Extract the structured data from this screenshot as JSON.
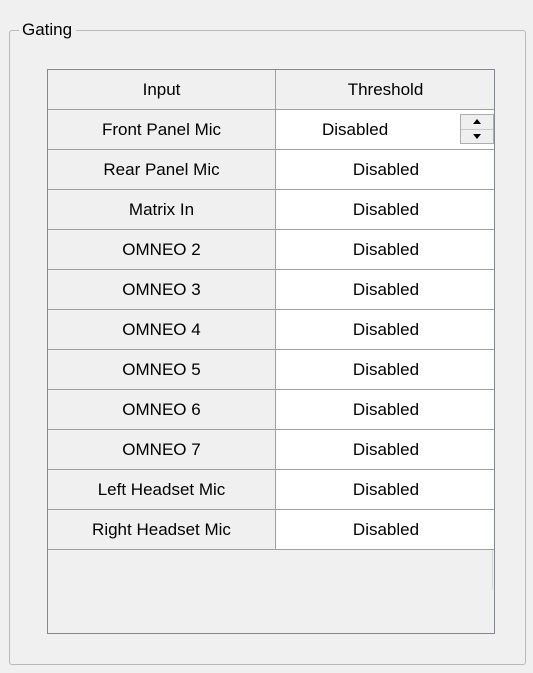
{
  "group": {
    "title": "Gating"
  },
  "grid": {
    "columns": [
      "Input",
      "Threshold"
    ],
    "rows": [
      {
        "input": "Front Panel Mic",
        "threshold": "Disabled"
      },
      {
        "input": "Rear Panel Mic",
        "threshold": "Disabled"
      },
      {
        "input": "Matrix In",
        "threshold": "Disabled"
      },
      {
        "input": "OMNEO 2",
        "threshold": "Disabled"
      },
      {
        "input": "OMNEO 3",
        "threshold": "Disabled"
      },
      {
        "input": "OMNEO 4",
        "threshold": "Disabled"
      },
      {
        "input": "OMNEO 5",
        "threshold": "Disabled"
      },
      {
        "input": "OMNEO 6",
        "threshold": "Disabled"
      },
      {
        "input": "OMNEO 7",
        "threshold": "Disabled"
      },
      {
        "input": "Left Headset Mic",
        "threshold": "Disabled"
      },
      {
        "input": "Right Headset Mic",
        "threshold": "Disabled"
      }
    ]
  },
  "icons": {
    "spin_up": "triangle-up-icon",
    "spin_down": "triangle-down-icon"
  }
}
